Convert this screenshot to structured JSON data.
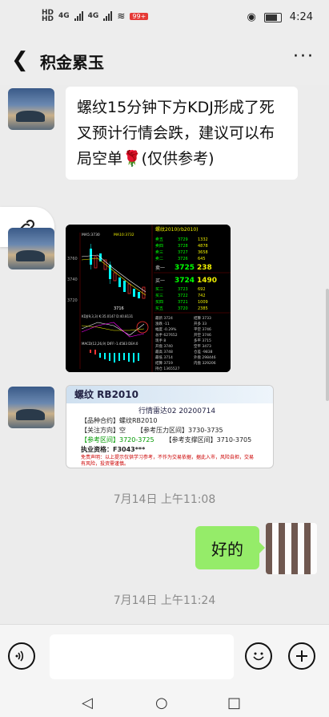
{
  "status_bar": {
    "hd1": "HD",
    "hd2": "HD",
    "net1": "4G",
    "net2": "4G",
    "badge": "99+",
    "time": "4:24"
  },
  "header": {
    "title": "积金累玉",
    "more_label": "···"
  },
  "messages": {
    "text_message": "螺纹15分钟下方KDJ形成了死叉预计行情会跌，建议可以布局空单🌹(仅供参考)",
    "chart_image": {
      "symbol": "螺纹2010(rb2010)",
      "prices": [
        "3729",
        "3728",
        "3728",
        "3727",
        "3726",
        "3725",
        "3724",
        "3723",
        "3722",
        "3721",
        "3720"
      ],
      "sell_volumes": [
        "1332",
        "4878",
        "3658",
        "645",
        "238"
      ],
      "buy_volumes": [
        "1490",
        "692",
        "742",
        "1009",
        "2385"
      ],
      "ask_price": "3725",
      "bid_price": "3724",
      "ask_vol": "238",
      "bid_vol": "1490",
      "stats_left": [
        "最新 3724",
        "涨跌 -11",
        "幅度 -0.29%",
        "总手 627652",
        "现手 8",
        "开盘 3740",
        "最高 3748",
        "最低 3714",
        "结算 3719",
        "持仓 1365527"
      ],
      "stats_right": [
        "结算 3733",
        "开多 33",
        "平空 3746",
        "开空 3746",
        "多平 3715",
        "空平 3473",
        "仓差 -9838",
        "外盘 298446",
        "内盘 329206"
      ],
      "indicator_labels": [
        "MA5:3730",
        "MA10:3732",
        "KDJ(9,3,3) K:35.0147 D:40.8131",
        "MACD(12,26,9) DIFF:-1.4583 DEA:0"
      ],
      "y_axis": [
        "3760",
        "3740",
        "3720"
      ]
    },
    "card_image": {
      "header": "螺纹 RB2010",
      "subtitle": "行情雷达02 20200714",
      "rows": [
        "【品种合约】螺纹RB2010",
        "【关注方向】空",
        "【参考区间】3720-3725",
        "【参考压力区间】3730-3735",
        "【参考支撑区间】3710-3705",
        "执业资格：F3043***"
      ],
      "disclaimer": "免责声明：以上提示仅供学习参考，不作为交易依据，据此入市，风险自担，交易有风险，投资需谨慎。"
    },
    "time1": "7月14日 上午11:08",
    "reply": "好的",
    "time2": "7月14日 上午11:24"
  },
  "input_bar": {
    "voice_icon": "voice-icon",
    "emoji_icon": "emoji-icon",
    "plus_icon": "plus-icon"
  },
  "nav_bar": {
    "back": "◁",
    "home": "○",
    "recent": "□"
  }
}
